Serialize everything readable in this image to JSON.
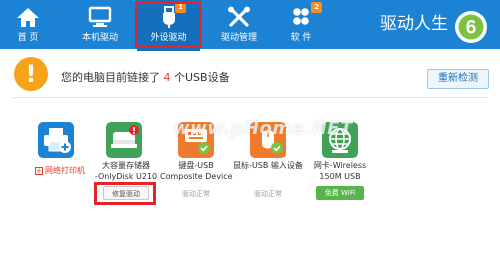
{
  "nav": {
    "items": [
      {
        "label": "首 页",
        "icon": "home-icon"
      },
      {
        "label": "本机驱动",
        "icon": "monitor-icon"
      },
      {
        "label": "外设驱动",
        "icon": "usb-icon",
        "badge": "1",
        "active": true
      },
      {
        "label": "驱动管理",
        "icon": "wrench-icon"
      },
      {
        "label": "软 件",
        "icon": "apps-icon",
        "badge": "2"
      }
    ],
    "brand": "驱动人生",
    "brand_logo_number": "6"
  },
  "banner": {
    "icon": "exclamation-icon",
    "text_before": "您的电脑目前链接了",
    "count": "4",
    "text_after": "个USB设备",
    "rescan_label": "重新检测"
  },
  "devices": [
    {
      "icon": "printer-icon",
      "name_line1": "网络打印机",
      "name_line2": "",
      "status": "",
      "button": ""
    },
    {
      "icon": "storage-icon",
      "name_line1": "大容量存储器",
      "name_line2": "-OnlyDisk U210",
      "status": "",
      "button": "修复驱动"
    },
    {
      "icon": "composite-device-icon",
      "name_line1": "键盘-USB",
      "name_line2": "Composite Device",
      "status": "驱动正常",
      "button": ""
    },
    {
      "icon": "mouse-icon",
      "name_line1": "鼠标-USB 输入设备",
      "name_line2": "",
      "status": "驱动正常",
      "button": ""
    },
    {
      "icon": "wifi-globe-icon",
      "name_line1": "网卡-Wireless",
      "name_line2": "150M USB",
      "status": "",
      "button": "免费 WiFi"
    }
  ],
  "watermark": "www.pHome.NET",
  "colors": {
    "topbar": "#1b82d4",
    "active_tab": "#1470bd",
    "highlight_box": "#e4252b",
    "warning": "#f7a21b",
    "count": "#e83b2a",
    "wifi_button": "#56b64a"
  }
}
